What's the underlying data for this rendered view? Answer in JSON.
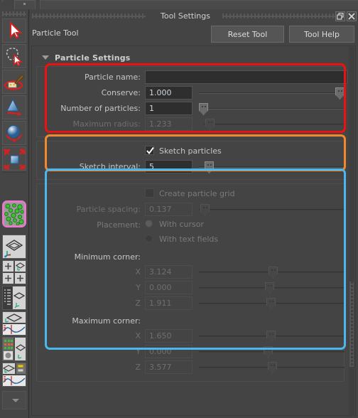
{
  "window": {
    "title": "Tool Settings",
    "restore_icon": "restore-icon",
    "close_icon": "close-icon"
  },
  "toolbar_top": {
    "tool_name": "Particle Tool",
    "reset_label": "Reset Tool",
    "help_label": "Tool Help"
  },
  "left_toolbar": {
    "items": [
      {
        "name": "select-tool-icon",
        "label": "Select Tool"
      },
      {
        "name": "lasso-select-tool-icon",
        "label": "Lasso Select Tool"
      },
      {
        "name": "paint-select-tool-icon",
        "label": "Paint Select Tool"
      },
      {
        "name": "move-tool-icon",
        "label": "Move Tool"
      },
      {
        "name": "rotate-tool-icon",
        "label": "Rotate Tool"
      },
      {
        "name": "scale-tool-icon",
        "label": "Scale Tool"
      },
      {
        "name": "particle-tool-icon",
        "label": "Particle Tool",
        "selected": true
      },
      {
        "name": "single-view-layout-icon",
        "label": "Single Perspective View"
      },
      {
        "name": "four-view-layout-icon",
        "label": "Four View Layout"
      },
      {
        "name": "outliner-persp-layout-icon",
        "label": "Outliner / Persp Layout"
      },
      {
        "name": "persp-graph-layout-icon",
        "label": "Persp / Graph Editor Layout"
      },
      {
        "name": "hypershade-persp-layout-icon",
        "label": "Hypershade / Persp Layout"
      },
      {
        "name": "persp-graph-hypergraph-layout-icon",
        "label": "Persp / Graph / Hypergraph Layout"
      },
      {
        "name": "more-layouts-icon",
        "label": "More Layouts"
      }
    ]
  },
  "section": {
    "title": "Particle Settings",
    "collapse_icon": "triangle-down-icon"
  },
  "groups": {
    "red": {
      "outline_color": "#ee1111",
      "fields": [
        {
          "name": "particle-name",
          "label": "Particle name:",
          "value": "",
          "type": "text",
          "width": "long",
          "disabled": false,
          "slider": false
        },
        {
          "name": "conserve",
          "label": "Conserve:",
          "value": "1.000",
          "type": "number",
          "disabled": false,
          "slider": true,
          "slider_pct": 100
        },
        {
          "name": "number-of-particles",
          "label": "Number of particles:",
          "value": "1",
          "type": "number",
          "disabled": false,
          "slider": true,
          "slider_pct": 0
        },
        {
          "name": "maximum-radius",
          "label": "Maximum radius:",
          "value": "1.233",
          "type": "number",
          "disabled": true,
          "slider": true,
          "slider_pct": 1
        }
      ]
    },
    "orange": {
      "outline_color": "#f08a2c",
      "checkbox": {
        "name": "sketch-particles",
        "label": "Sketch particles",
        "checked": true,
        "disabled": false
      },
      "fields": [
        {
          "name": "sketch-interval",
          "label": "Sketch interval:",
          "value": "5",
          "type": "number",
          "disabled": false,
          "slider": true,
          "slider_pct": 4
        }
      ]
    },
    "blue": {
      "outline_color": "#4ab8ee",
      "checkbox": {
        "name": "create-particle-grid",
        "label": "Create particle grid",
        "checked": false,
        "disabled": true
      },
      "spacing": {
        "name": "particle-spacing",
        "label": "Particle spacing:",
        "value": "0.137",
        "disabled": true,
        "slider_pct": 1
      },
      "placement": {
        "label": "Placement:",
        "options": [
          {
            "name": "placement-with-cursor",
            "label": "With cursor",
            "selected": true
          },
          {
            "name": "placement-with-text-fields",
            "label": "With text fields",
            "selected": false
          }
        ]
      },
      "minimum_corner": {
        "label": "Minimum corner:",
        "axes": [
          {
            "name": "min-corner-x",
            "label": "X",
            "value": "3.124",
            "slider_pct": 50
          },
          {
            "name": "min-corner-y",
            "label": "Y",
            "value": "0.000",
            "slider_pct": 48
          },
          {
            "name": "min-corner-z",
            "label": "Z",
            "value": "1.911",
            "slider_pct": 49
          }
        ]
      },
      "maximum_corner": {
        "label": "Maximum corner:",
        "axes": [
          {
            "name": "max-corner-x",
            "label": "X",
            "value": "1.650",
            "slider_pct": 49
          },
          {
            "name": "max-corner-y",
            "label": "Y",
            "value": "0.000",
            "slider_pct": 47
          },
          {
            "name": "max-corner-z",
            "label": "Z",
            "value": "3.577",
            "slider_pct": 50
          }
        ]
      }
    }
  }
}
